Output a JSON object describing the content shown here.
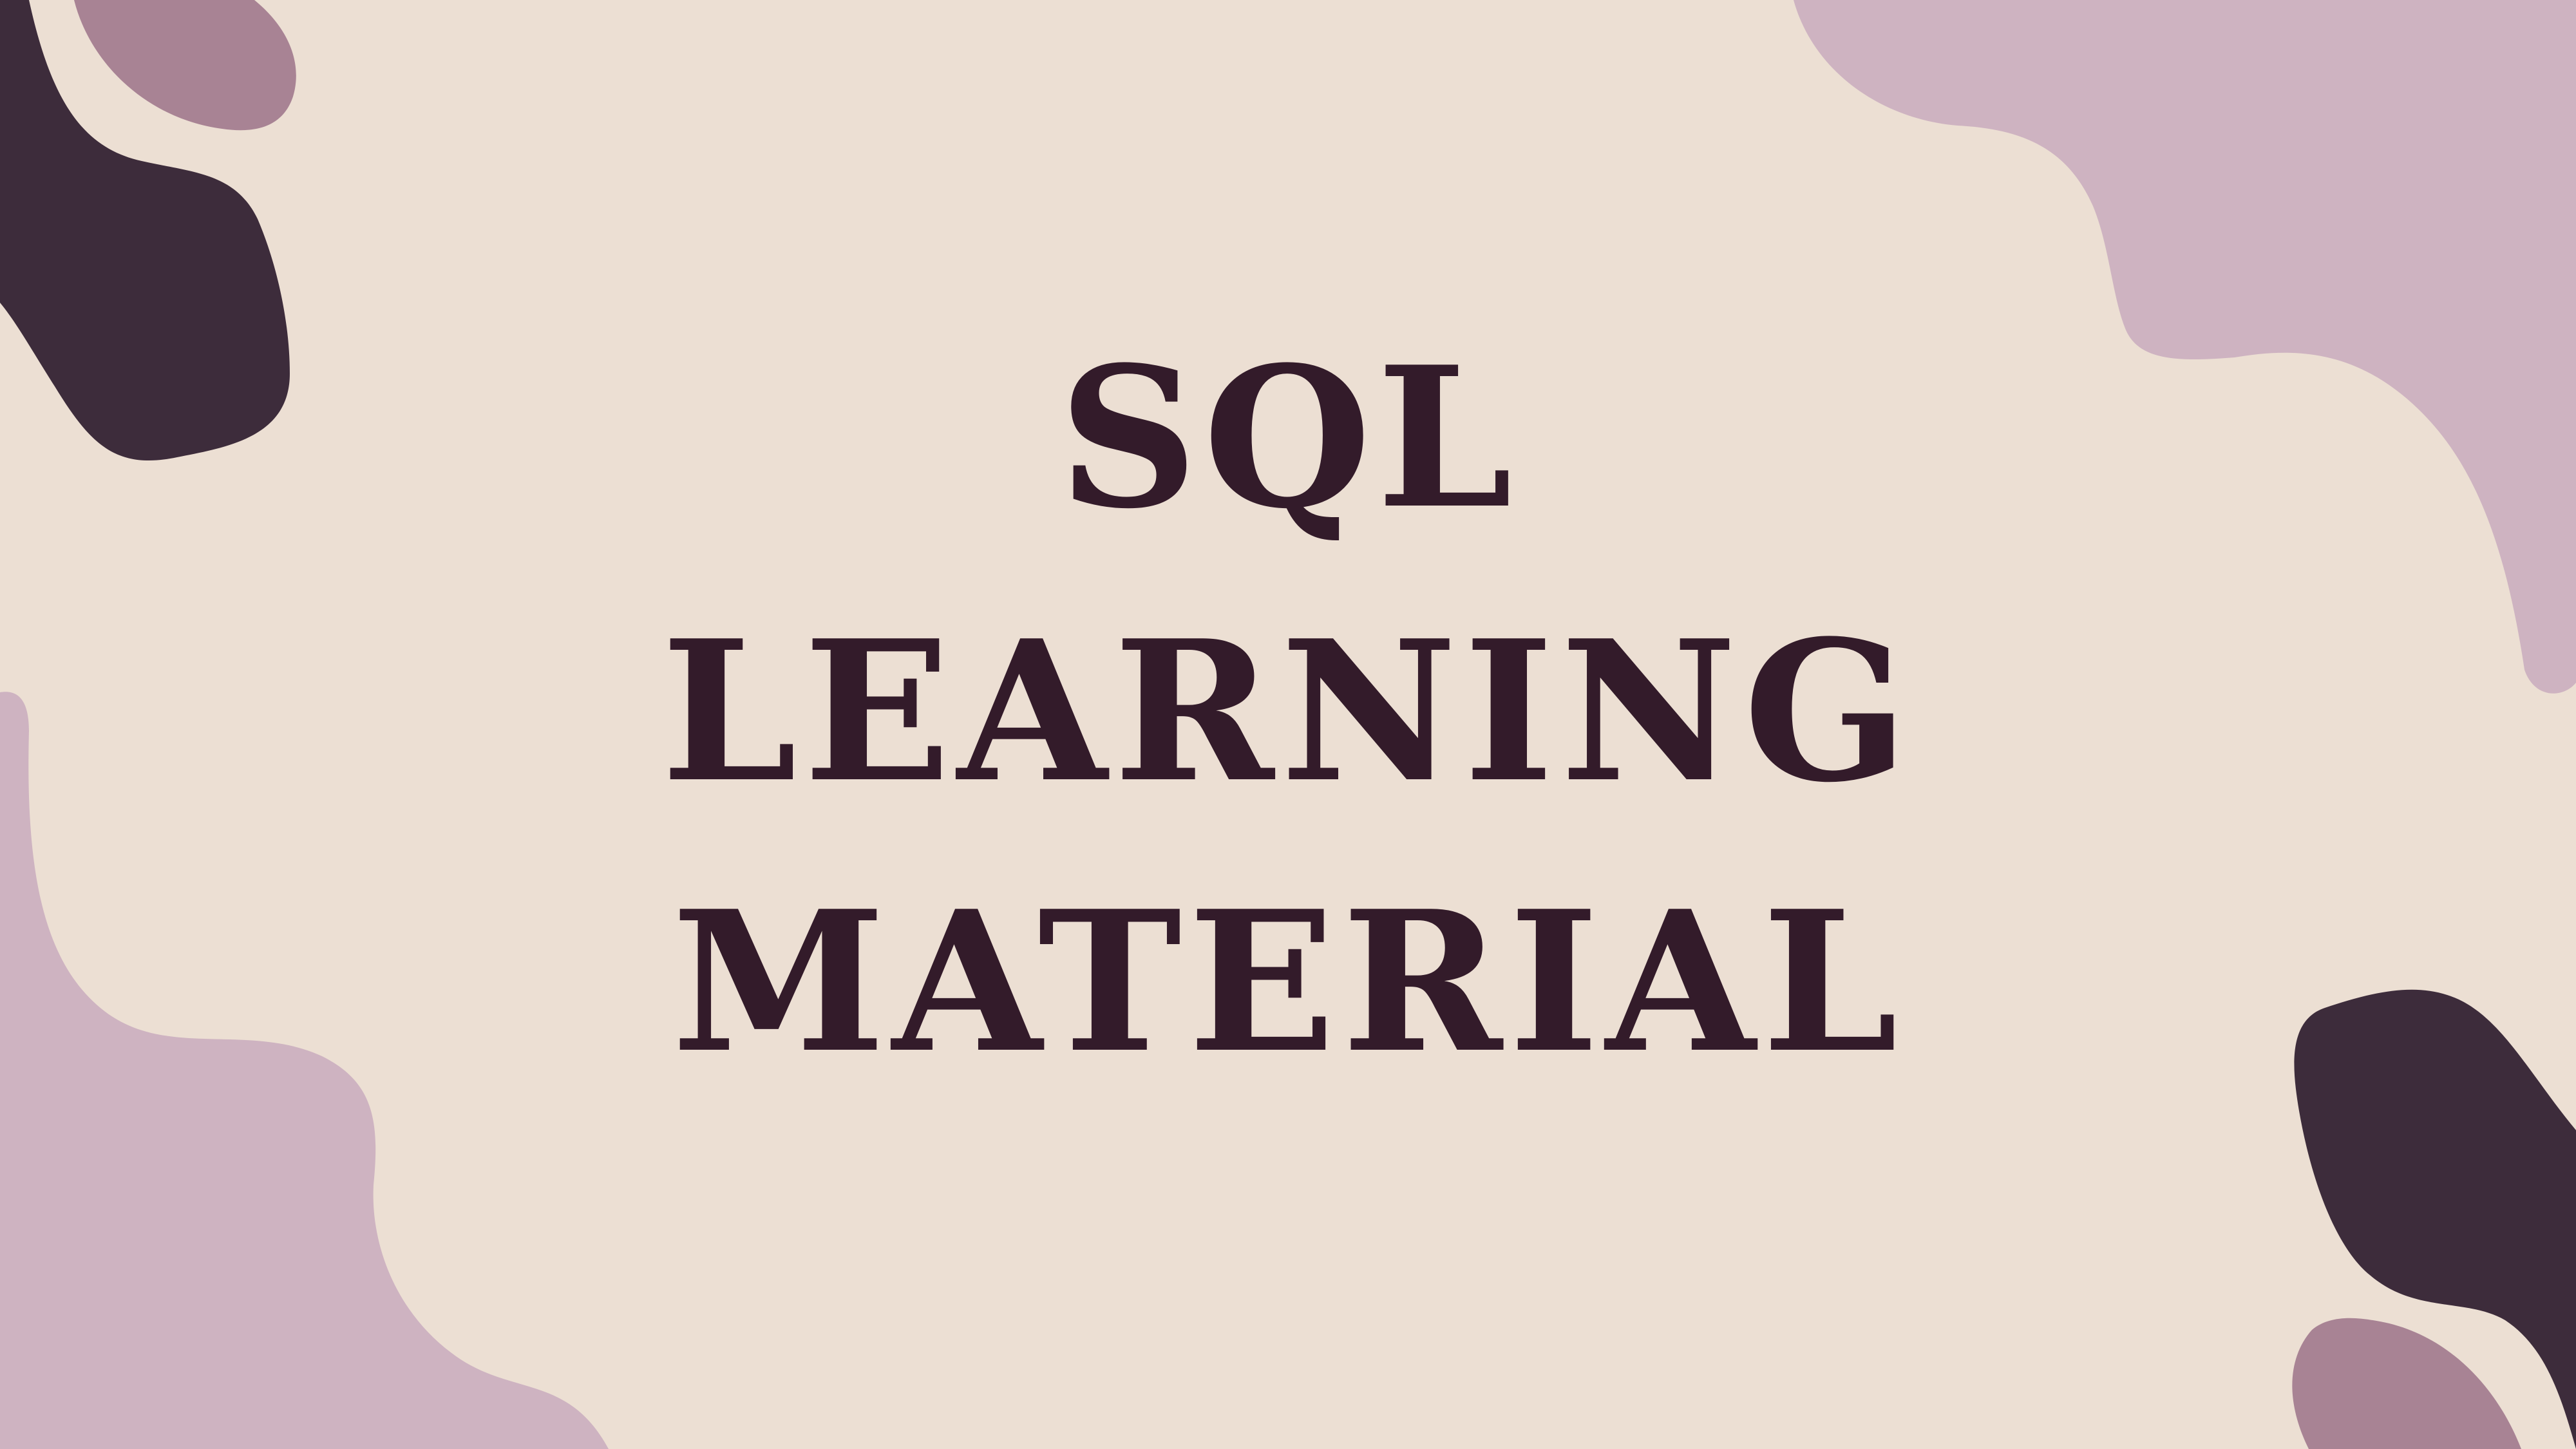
{
  "slide": {
    "title_lines": [
      "SQL",
      "LEARNING",
      "MATERIAL"
    ]
  },
  "colors": {
    "background": "#ecdfd3",
    "text": "#331b2a",
    "blob_dark": "#3d2c3b",
    "blob_light": "#ceb3c1",
    "blob_medium": "#a88394"
  }
}
